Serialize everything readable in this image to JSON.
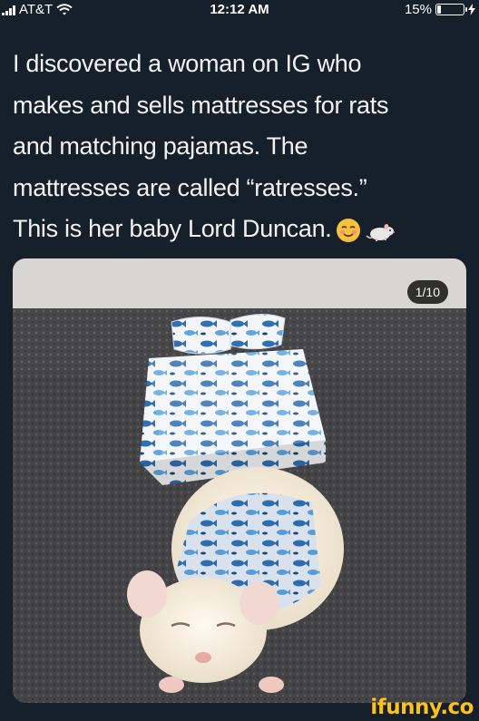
{
  "status_bar": {
    "carrier": "AT&T",
    "time": "12:12 AM",
    "battery": "15%",
    "battery_level": 0.15,
    "icons": [
      "signal-bars-icon",
      "wifi-icon",
      "battery-icon",
      "charging-bolt-icon"
    ]
  },
  "tweet": {
    "lines": [
      "I discovered a woman on IG who",
      "makes and sells mattresses for rats",
      "and matching pajamas. The",
      "mattresses are called “ratresses.”",
      "This is her baby Lord Duncan."
    ],
    "emojis": [
      "smiling-face-emoji",
      "rat-emoji"
    ]
  },
  "photo": {
    "counter": "1/10",
    "subject": "rat-in-pajamas-with-mattress"
  },
  "watermark": {
    "text": "ifunny.co",
    "color": "#fbc21c"
  },
  "colors": {
    "background": "#15202b",
    "text": "#f2f2f2"
  }
}
